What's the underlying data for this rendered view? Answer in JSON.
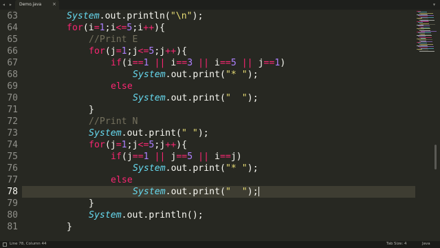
{
  "colors": {
    "background": "#272822",
    "keyword": "#f92672",
    "number": "#ae81ff",
    "string": "#e6db74",
    "comment": "#75715e",
    "class_name": "#66d9ef",
    "plain": "#f8f8f2"
  },
  "tabbar": {
    "nav_left_icon": "chevron-left-icon",
    "nav_right_icon": "chevron-right-icon",
    "tab_label": "Demo.java",
    "tab_close": "×",
    "menu_icon": "tab-list-icon"
  },
  "editor": {
    "active_line": 78,
    "lines": [
      {
        "n": "63",
        "tokens": [
          {
            "t": "System",
            "c": "class_name",
            "i": true
          },
          {
            "t": ".out.println(",
            "c": "plain"
          },
          {
            "t": "\"\\n\"",
            "c": "string"
          },
          {
            "t": ");",
            "c": "plain"
          }
        ],
        "indent": 2
      },
      {
        "n": "64",
        "tokens": [
          {
            "t": "for",
            "c": "keyword"
          },
          {
            "t": "(i",
            "c": "plain"
          },
          {
            "t": "=",
            "c": "keyword"
          },
          {
            "t": "1",
            "c": "number"
          },
          {
            "t": ";i",
            "c": "plain"
          },
          {
            "t": "<=",
            "c": "keyword"
          },
          {
            "t": "5",
            "c": "number"
          },
          {
            "t": ";i",
            "c": "plain"
          },
          {
            "t": "++",
            "c": "keyword"
          },
          {
            "t": "){",
            "c": "plain"
          }
        ],
        "indent": 2
      },
      {
        "n": "65",
        "tokens": [
          {
            "t": "//Print E",
            "c": "comment"
          }
        ],
        "indent": 3
      },
      {
        "n": "66",
        "tokens": [
          {
            "t": "for",
            "c": "keyword"
          },
          {
            "t": "(j",
            "c": "plain"
          },
          {
            "t": "=",
            "c": "keyword"
          },
          {
            "t": "1",
            "c": "number"
          },
          {
            "t": ";j",
            "c": "plain"
          },
          {
            "t": "<=",
            "c": "keyword"
          },
          {
            "t": "5",
            "c": "number"
          },
          {
            "t": ";j",
            "c": "plain"
          },
          {
            "t": "++",
            "c": "keyword"
          },
          {
            "t": "){",
            "c": "plain"
          }
        ],
        "indent": 3
      },
      {
        "n": "67",
        "tokens": [
          {
            "t": "if",
            "c": "keyword"
          },
          {
            "t": "(i",
            "c": "plain"
          },
          {
            "t": "==",
            "c": "keyword"
          },
          {
            "t": "1",
            "c": "number"
          },
          {
            "t": " ",
            "c": "plain"
          },
          {
            "t": "||",
            "c": "keyword"
          },
          {
            "t": " i",
            "c": "plain"
          },
          {
            "t": "==",
            "c": "keyword"
          },
          {
            "t": "3",
            "c": "number"
          },
          {
            "t": " ",
            "c": "plain"
          },
          {
            "t": "||",
            "c": "keyword"
          },
          {
            "t": " i",
            "c": "plain"
          },
          {
            "t": "==",
            "c": "keyword"
          },
          {
            "t": "5",
            "c": "number"
          },
          {
            "t": " ",
            "c": "plain"
          },
          {
            "t": "||",
            "c": "keyword"
          },
          {
            "t": " j",
            "c": "plain"
          },
          {
            "t": "==",
            "c": "keyword"
          },
          {
            "t": "1",
            "c": "number"
          },
          {
            "t": ")",
            "c": "plain"
          }
        ],
        "indent": 4
      },
      {
        "n": "68",
        "tokens": [
          {
            "t": "System",
            "c": "class_name",
            "i": true
          },
          {
            "t": ".out.print(",
            "c": "plain"
          },
          {
            "t": "\"* \"",
            "c": "string"
          },
          {
            "t": ");",
            "c": "plain"
          }
        ],
        "indent": 5
      },
      {
        "n": "69",
        "tokens": [
          {
            "t": "else",
            "c": "keyword"
          }
        ],
        "indent": 4
      },
      {
        "n": "70",
        "tokens": [
          {
            "t": "System",
            "c": "class_name",
            "i": true
          },
          {
            "t": ".out.print(",
            "c": "plain"
          },
          {
            "t": "\"  \"",
            "c": "string"
          },
          {
            "t": ");",
            "c": "plain"
          }
        ],
        "indent": 5
      },
      {
        "n": "71",
        "tokens": [
          {
            "t": "}",
            "c": "plain"
          }
        ],
        "indent": 3
      },
      {
        "n": "72",
        "tokens": [
          {
            "t": "//Print N",
            "c": "comment"
          }
        ],
        "indent": 3
      },
      {
        "n": "73",
        "tokens": [
          {
            "t": "System",
            "c": "class_name",
            "i": true
          },
          {
            "t": ".out.print(",
            "c": "plain"
          },
          {
            "t": "\" \"",
            "c": "string"
          },
          {
            "t": ");",
            "c": "plain"
          }
        ],
        "indent": 3
      },
      {
        "n": "74",
        "tokens": [
          {
            "t": "for",
            "c": "keyword"
          },
          {
            "t": "(j",
            "c": "plain"
          },
          {
            "t": "=",
            "c": "keyword"
          },
          {
            "t": "1",
            "c": "number"
          },
          {
            "t": ";j",
            "c": "plain"
          },
          {
            "t": "<=",
            "c": "keyword"
          },
          {
            "t": "5",
            "c": "number"
          },
          {
            "t": ";j",
            "c": "plain"
          },
          {
            "t": "++",
            "c": "keyword"
          },
          {
            "t": "){",
            "c": "plain"
          }
        ],
        "indent": 3
      },
      {
        "n": "75",
        "tokens": [
          {
            "t": "if",
            "c": "keyword"
          },
          {
            "t": "(j",
            "c": "plain"
          },
          {
            "t": "==",
            "c": "keyword"
          },
          {
            "t": "1",
            "c": "number"
          },
          {
            "t": " ",
            "c": "plain"
          },
          {
            "t": "||",
            "c": "keyword"
          },
          {
            "t": " j",
            "c": "plain"
          },
          {
            "t": "==",
            "c": "keyword"
          },
          {
            "t": "5",
            "c": "number"
          },
          {
            "t": " ",
            "c": "plain"
          },
          {
            "t": "||",
            "c": "keyword"
          },
          {
            "t": " i",
            "c": "plain"
          },
          {
            "t": "==",
            "c": "keyword"
          },
          {
            "t": "j)",
            "c": "plain"
          }
        ],
        "indent": 4
      },
      {
        "n": "76",
        "tokens": [
          {
            "t": "System",
            "c": "class_name",
            "i": true
          },
          {
            "t": ".out.print(",
            "c": "plain"
          },
          {
            "t": "\"* \"",
            "c": "string"
          },
          {
            "t": ");",
            "c": "plain"
          }
        ],
        "indent": 5
      },
      {
        "n": "77",
        "tokens": [
          {
            "t": "else",
            "c": "keyword"
          }
        ],
        "indent": 4
      },
      {
        "n": "78",
        "tokens": [
          {
            "t": "System",
            "c": "class_name",
            "i": true
          },
          {
            "t": ".out.print(",
            "c": "plain"
          },
          {
            "t": "\"  \"",
            "c": "string"
          },
          {
            "t": ");",
            "c": "plain"
          }
        ],
        "indent": 5,
        "cursor": true
      },
      {
        "n": "79",
        "tokens": [
          {
            "t": "}",
            "c": "plain"
          }
        ],
        "indent": 3
      },
      {
        "n": "80",
        "tokens": [
          {
            "t": "System",
            "c": "class_name",
            "i": true
          },
          {
            "t": ".out.println();",
            "c": "plain"
          }
        ],
        "indent": 3
      },
      {
        "n": "81",
        "tokens": [
          {
            "t": "}",
            "c": "plain"
          }
        ],
        "indent": 2
      }
    ]
  },
  "statusbar": {
    "status_icon": "panel-toggle-icon",
    "position": "Line 78, Column 44",
    "tab_size": "Tab Size: 4",
    "syntax": "Java"
  }
}
